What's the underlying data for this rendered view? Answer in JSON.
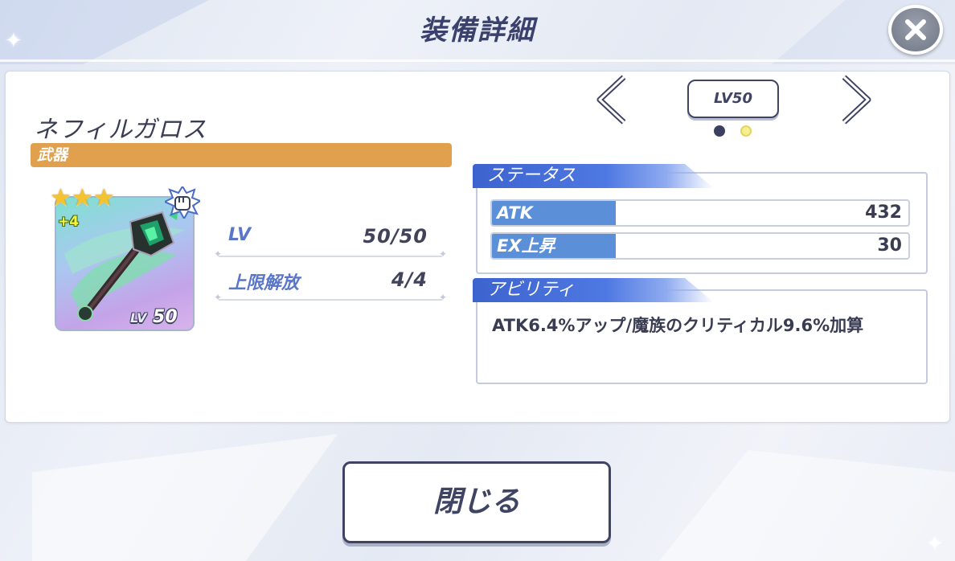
{
  "header": {
    "title": "装備詳細"
  },
  "item": {
    "name": "ネフィルガロス",
    "category": "武器",
    "rarity_stars": 3,
    "plus": "+4",
    "card_level_prefix": "LV",
    "card_level_value": "50"
  },
  "info": {
    "lv_label": "LV",
    "lv_value": "50/50",
    "limit_label": "上限解放",
    "limit_value": "4/4"
  },
  "level_selector": {
    "label": "LV50",
    "pages": 2,
    "current_page": 1
  },
  "status": {
    "title": "ステータス",
    "rows": [
      {
        "label": "ATK",
        "value": "432"
      },
      {
        "label": "EX上昇",
        "value": "30"
      }
    ]
  },
  "ability": {
    "title": "アビリティ",
    "text": "ATK6.4%アップ/魔族のクリティカル9.6%加算"
  },
  "footer": {
    "close_label": "閉じる"
  },
  "colors": {
    "accent_blue": "#4e78e2",
    "category_orange": "#e0a04e",
    "stat_label_blue": "#5b90d8",
    "text_dark": "#3a3f63"
  }
}
